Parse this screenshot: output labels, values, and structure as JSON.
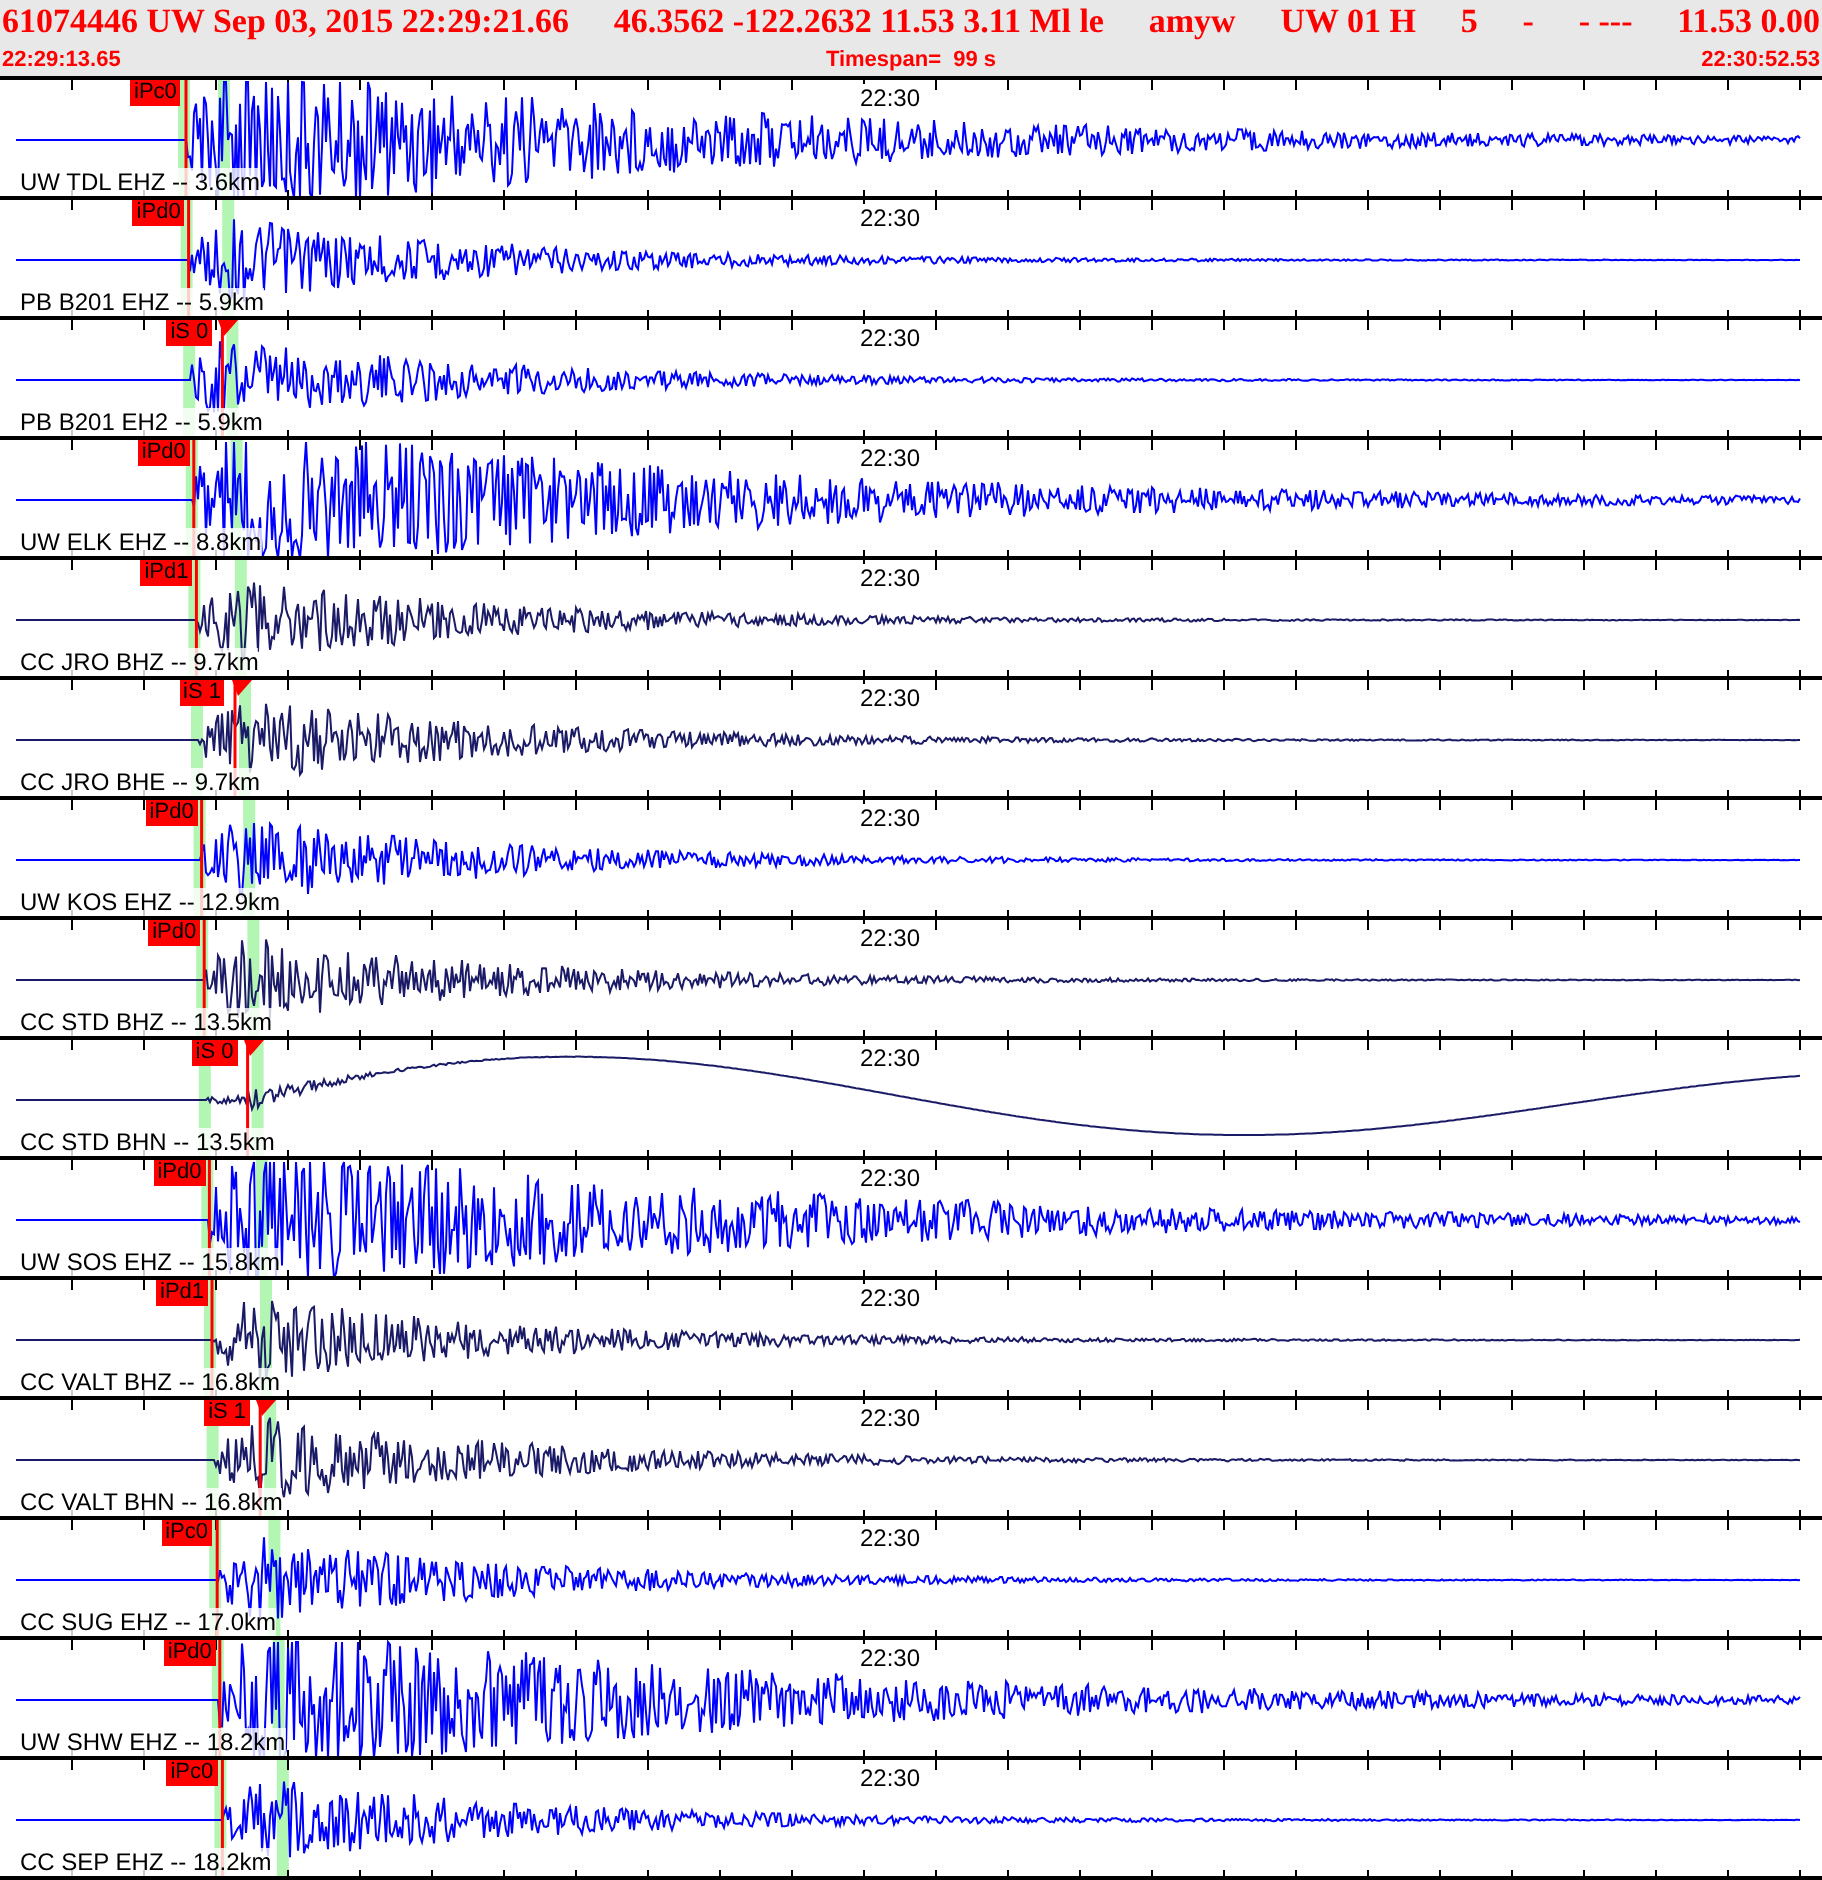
{
  "header": {
    "summary": [
      "61074446 UW Sep 03, 2015 22:29:21.66",
      "46.3562 -122.2632 11.53 3.11 Ml le",
      "amyw",
      "UW 01 H",
      "5",
      "-",
      "- ---",
      "11.53 0.00"
    ],
    "start_time": "22:29:13.65",
    "timespan": "Timespan=  99 s",
    "end_time": "22:30:52.53"
  },
  "traces": [
    {
      "label": "UW TDL EHZ -- 3.6km",
      "pick": {
        "text": "iPc0",
        "kind": "p"
      },
      "color": "#0000ff",
      "waveform": {
        "kind": "strong"
      },
      "time_mark": "22:30"
    },
    {
      "label": "PB B201 EHZ -- 5.9km",
      "pick": {
        "text": "iPd0",
        "kind": "p"
      },
      "color": "#0000ff",
      "waveform": {
        "kind": "moderate"
      },
      "time_mark": "22:30"
    },
    {
      "label": "PB B201 EH2 -- 5.9km",
      "pick": {
        "text": "iS 0",
        "kind": "s"
      },
      "color": "#0000ff",
      "waveform": {
        "kind": "moderate"
      },
      "time_mark": "22:30"
    },
    {
      "label": "UW ELK EHZ -- 8.8km",
      "pick": {
        "text": "iPd0",
        "kind": "p"
      },
      "color": "#0000ff",
      "waveform": {
        "kind": "strong"
      },
      "time_mark": "22:30"
    },
    {
      "label": "CC JRO BHZ -- 9.7km",
      "pick": {
        "text": "iPd1",
        "kind": "p"
      },
      "color": "#1a1a66",
      "waveform": {
        "kind": "moderate"
      },
      "time_mark": "22:30"
    },
    {
      "label": "CC JRO BHE -- 9.7km",
      "pick": {
        "text": "iS 1",
        "kind": "s"
      },
      "color": "#1a1a66",
      "waveform": {
        "kind": "moderate"
      },
      "time_mark": "22:30"
    },
    {
      "label": "UW KOS EHZ -- 12.9km",
      "pick": {
        "text": "iPd0",
        "kind": "p"
      },
      "color": "#0000ff",
      "waveform": {
        "kind": "moderate"
      },
      "time_mark": "22:30"
    },
    {
      "label": "CC STD BHZ -- 13.5km",
      "pick": {
        "text": "iPd0",
        "kind": "p"
      },
      "color": "#1a1a66",
      "waveform": {
        "kind": "moderate"
      },
      "time_mark": "22:30"
    },
    {
      "label": "CC STD BHN -- 13.5km",
      "pick": {
        "text": "iS 0",
        "kind": "s"
      },
      "color": "#1a1a66",
      "waveform": {
        "kind": "swell"
      },
      "time_mark": "22:30"
    },
    {
      "label": "UW SOS EHZ -- 15.8km",
      "pick": {
        "text": "iPd0",
        "kind": "p"
      },
      "color": "#0000ff",
      "waveform": {
        "kind": "strong"
      },
      "time_mark": "22:30"
    },
    {
      "label": "CC VALT BHZ -- 16.8km",
      "pick": {
        "text": "iPd1",
        "kind": "p"
      },
      "color": "#1a1a66",
      "waveform": {
        "kind": "moderate"
      },
      "time_mark": "22:30"
    },
    {
      "label": "CC VALT BHN -- 16.8km",
      "pick": {
        "text": "iS 1",
        "kind": "s"
      },
      "color": "#1a1a66",
      "waveform": {
        "kind": "moderate"
      },
      "time_mark": "22:30"
    },
    {
      "label": "CC SUG EHZ -- 17.0km",
      "pick": {
        "text": "iPc0",
        "kind": "p"
      },
      "color": "#0000ff",
      "waveform": {
        "kind": "moderate"
      },
      "time_mark": "22:30"
    },
    {
      "label": "UW SHW EHZ -- 18.2km",
      "pick": {
        "text": "iPd0",
        "kind": "p"
      },
      "color": "#0000ff",
      "waveform": {
        "kind": "strong"
      },
      "time_mark": "22:30"
    },
    {
      "label": "CC SEP EHZ -- 18.2km",
      "pick": {
        "text": "iPc0",
        "kind": "p"
      },
      "color": "#0000ff",
      "waveform": {
        "kind": "moderate"
      },
      "time_mark": "22:30"
    }
  ]
}
